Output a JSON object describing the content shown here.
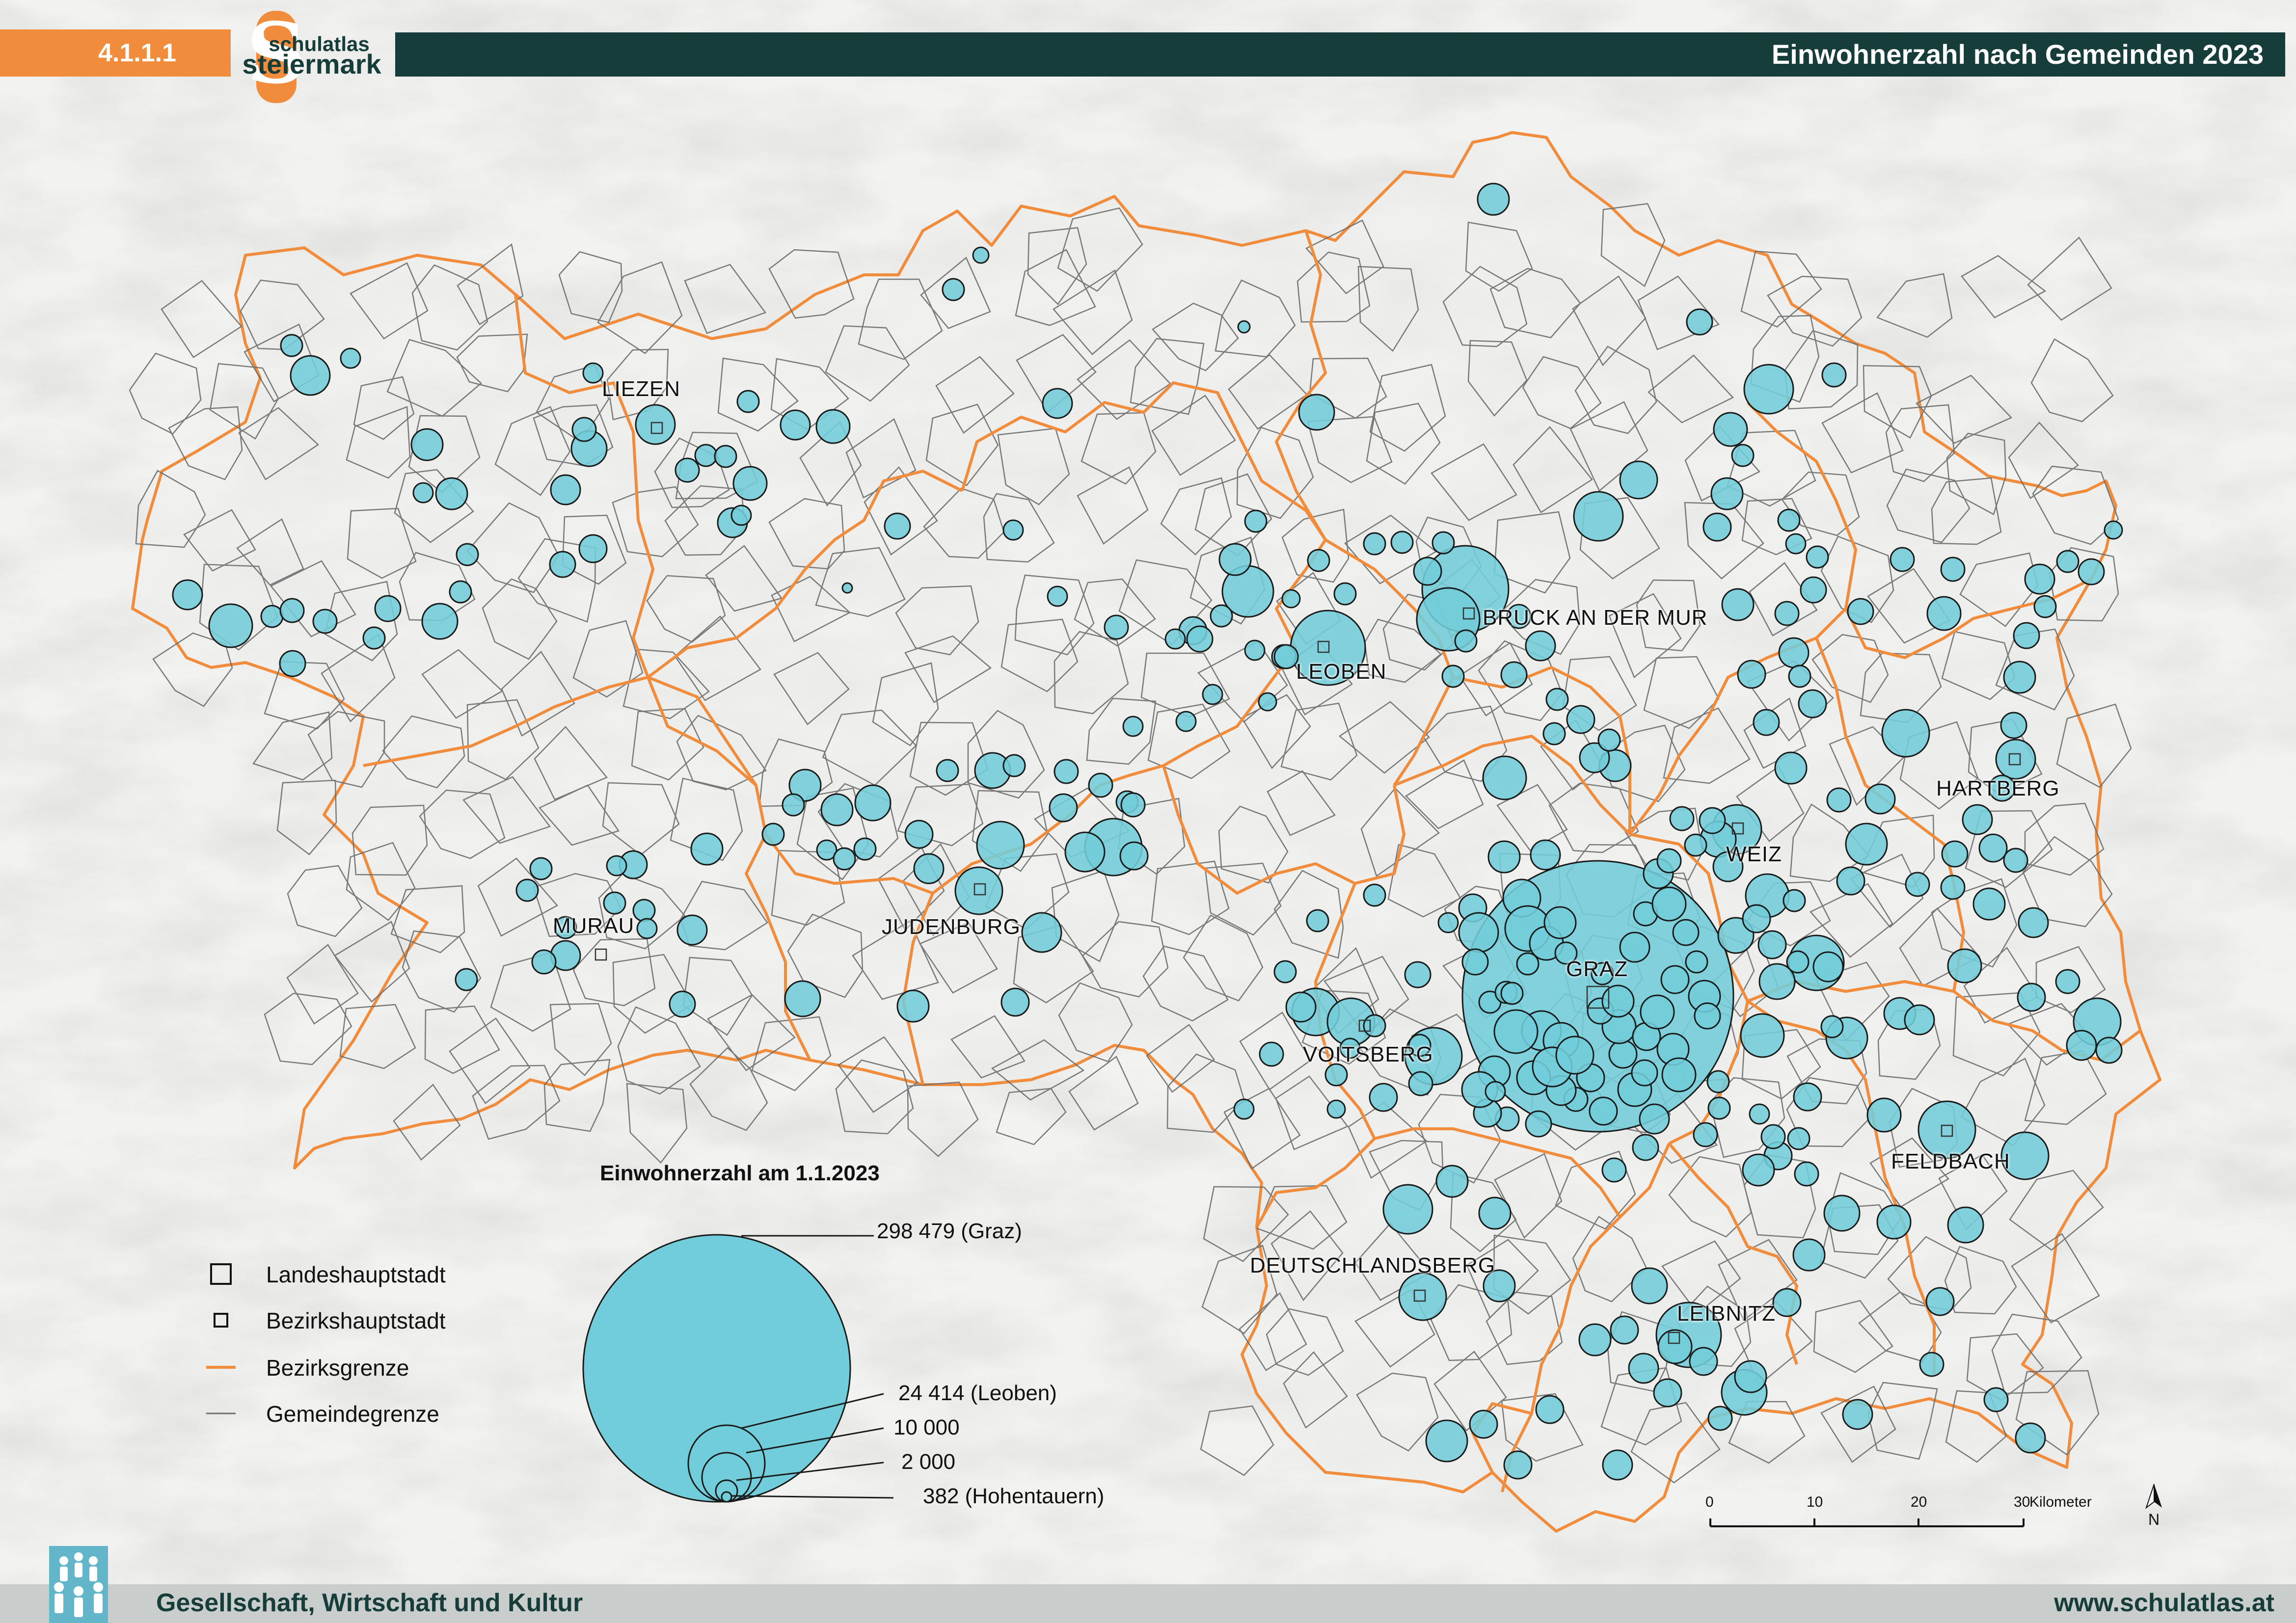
{
  "header": {
    "section_number": "4.1.1.1",
    "logo_text_top": "schulatlas",
    "logo_text_bottom": "steiermark",
    "logo_letter": "S",
    "title": "Einwohnerzahl nach Gemeinden 2023"
  },
  "colors": {
    "orange": "#f08c3c",
    "dark_teal": "#173d3a",
    "circle_fill": "#71cdd9",
    "circle_stroke": "#1a1a1a",
    "district_border": "#f08c3c",
    "municipal_border": "#6d6d6d",
    "footer_bg": "#c9cecc",
    "footer_icon": "#63b6c9"
  },
  "places": [
    {
      "name": "LIEZEN"
    },
    {
      "name": "BRUCK AN DER MUR"
    },
    {
      "name": "LEOBEN"
    },
    {
      "name": "HARTBERG"
    },
    {
      "name": "WEIZ"
    },
    {
      "name": "MURAU"
    },
    {
      "name": "JUDENBURG"
    },
    {
      "name": "GRAZ"
    },
    {
      "name": "VOITSBERG"
    },
    {
      "name": "FELDBACH"
    },
    {
      "name": "DEUTSCHLANDSBERG"
    },
    {
      "name": "LEIBNITZ"
    }
  ],
  "legend": {
    "title": "Einwohnerzahl am 1.1.2023",
    "sizes": [
      {
        "value": 298479,
        "label": "298 479 (Graz)"
      },
      {
        "value": 24414,
        "label": "24 414 (Leoben)"
      },
      {
        "value": 10000,
        "label": "10 000"
      },
      {
        "value": 2000,
        "label": "2 000"
      },
      {
        "value": 382,
        "label": "382 (Hohentauern)"
      }
    ],
    "items": [
      {
        "label": "Landeshauptstadt",
        "icon": "large-square-icon"
      },
      {
        "label": "Bezirkshauptstadt",
        "icon": "small-square-icon"
      },
      {
        "label": "Bezirksgrenze",
        "icon": "orange-line-icon"
      },
      {
        "label": "Gemeindegrenze",
        "icon": "gray-line-icon"
      }
    ]
  },
  "scale_bar": {
    "ticks": [
      "0",
      "10",
      "20",
      "30"
    ],
    "unit": "Kilometer",
    "north_label": "N"
  },
  "footer": {
    "left": "Gesellschaft, Wirtschaft und Kultur",
    "right": "www.schulatlas.at"
  }
}
